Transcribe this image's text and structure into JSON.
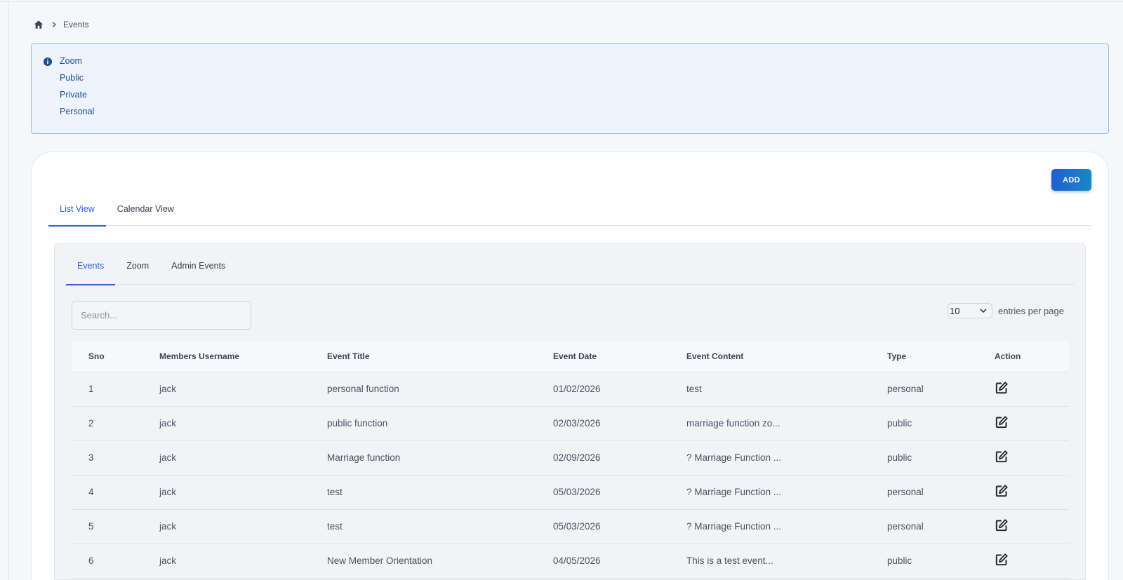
{
  "breadcrumb": {
    "home_icon": "home-icon",
    "separator_icon": "chevron-right-icon",
    "current": "Events"
  },
  "info": {
    "icon": "info-icon",
    "items": [
      "Zoom",
      "Public",
      "Private",
      "Personal"
    ]
  },
  "add_button": {
    "label": "ADD"
  },
  "view_tabs": [
    {
      "label": "List View",
      "active": true
    },
    {
      "label": "Calendar View",
      "active": false
    }
  ],
  "sub_tabs": [
    {
      "label": "Events",
      "active": true
    },
    {
      "label": "Zoom",
      "active": false
    },
    {
      "label": "Admin Events",
      "active": false
    }
  ],
  "search": {
    "placeholder": "Search...",
    "value": ""
  },
  "entries": {
    "selected": "10",
    "label": "entries per page"
  },
  "table": {
    "headers": [
      "Sno",
      "Members Username",
      "Event Title",
      "Event Date",
      "Event Content",
      "Type",
      "Action"
    ],
    "rows": [
      [
        "1",
        "jack",
        "personal function",
        "01/02/2026",
        "test",
        "personal"
      ],
      [
        "2",
        "jack",
        "public function",
        "02/03/2026",
        "marriage function zo...",
        "public"
      ],
      [
        "3",
        "jack",
        "Marriage function",
        "02/09/2026",
        "? Marriage Function ...",
        "public"
      ],
      [
        "4",
        "jack",
        "test",
        "05/03/2026",
        "? Marriage Function ...",
        "personal"
      ],
      [
        "5",
        "jack",
        "test",
        "05/03/2026",
        "? Marriage Function ...",
        "personal"
      ],
      [
        "6",
        "jack",
        "New Member Orientation",
        "04/05/2026",
        "This is a test event...",
        "public"
      ]
    ],
    "action_icon": "edit-icon"
  },
  "colors": {
    "accent": "#2b65d9",
    "info_bg": "#edf4fd",
    "info_border": "#8fbde8",
    "info_text": "#1f4e8c"
  }
}
